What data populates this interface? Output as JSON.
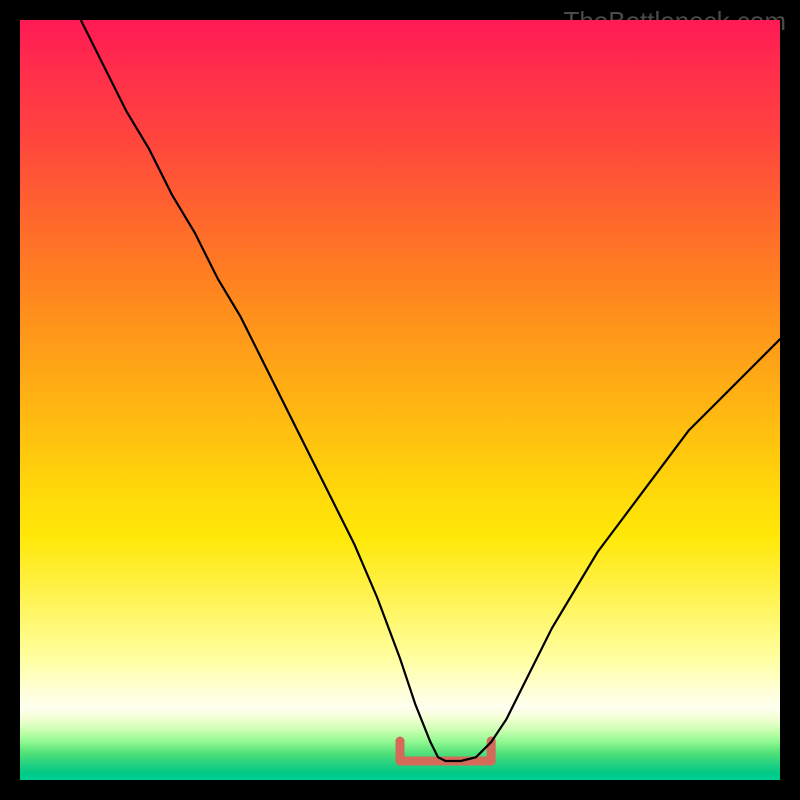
{
  "watermark": "TheBottleneck.com",
  "colors": {
    "frame_bg": "#000000",
    "curve": "#000000",
    "bottom_mark": "#d46a5a",
    "watermark": "#4a4a4a"
  },
  "chart_data": {
    "type": "line",
    "title": "",
    "xlabel": "",
    "ylabel": "",
    "xlim": [
      0,
      100
    ],
    "ylim": [
      0,
      100
    ],
    "series": [
      {
        "name": "bottleneck-curve",
        "x": [
          8,
          11,
          14,
          17,
          20,
          23,
          26,
          29,
          32,
          35,
          38,
          41,
          44,
          47,
          50,
          52,
          54,
          55,
          56,
          58,
          60,
          62,
          64,
          66,
          68,
          70,
          73,
          76,
          79,
          82,
          85,
          88,
          91,
          94,
          97,
          100
        ],
        "values": [
          100,
          94,
          88,
          83,
          77,
          72,
          66,
          61,
          55,
          49,
          43,
          37,
          31,
          24,
          16,
          10,
          5,
          3,
          2.5,
          2.5,
          3,
          5,
          8,
          12,
          16,
          20,
          25,
          30,
          34,
          38,
          42,
          46,
          49,
          52,
          55,
          58
        ]
      }
    ],
    "bottom_marker": {
      "x_range": [
        50,
        62
      ],
      "y": 2.5
    },
    "gradient_stops": [
      {
        "pos": 0.0,
        "color": "#ff1a55"
      },
      {
        "pos": 0.24,
        "color": "#ff6030"
      },
      {
        "pos": 0.54,
        "color": "#ffbf10"
      },
      {
        "pos": 0.84,
        "color": "#ffffc8"
      },
      {
        "pos": 0.95,
        "color": "#90f890"
      },
      {
        "pos": 1.0,
        "color": "#00d098"
      }
    ]
  }
}
